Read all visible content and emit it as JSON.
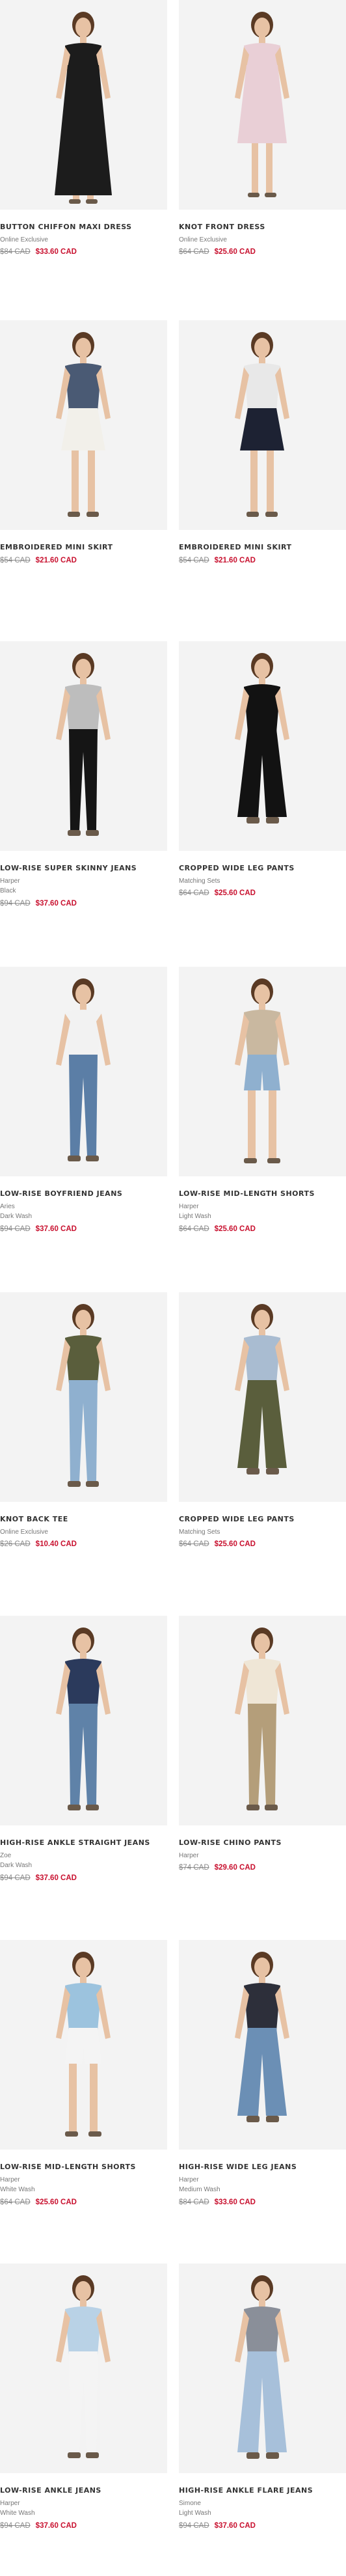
{
  "colors": {
    "sale": "#c8102e",
    "original": "#8a8a8a",
    "background": "#ffffff",
    "photo_background": "#f3f3f3"
  },
  "products": [
    {
      "name": "BUTTON CHIFFON MAXI DRESS",
      "meta1": "Online Exclusive",
      "meta2": "",
      "original_price": "$84 CAD",
      "sale_price": "$33.60 CAD",
      "image_icon": "model-maxi-dress-photo",
      "garment_color": "#1c1c1c",
      "top_color": "#1c1c1c",
      "kind": "maxi"
    },
    {
      "name": "KNOT FRONT DRESS",
      "meta1": "Online Exclusive",
      "meta2": "",
      "original_price": "$64 CAD",
      "sale_price": "$25.60 CAD",
      "image_icon": "model-floral-dress-photo",
      "garment_color": "#e9cfd6",
      "top_color": "#e9cfd6",
      "kind": "dress"
    },
    {
      "name": "EMBROIDERED MINI SKIRT",
      "meta1": "",
      "meta2": "",
      "original_price": "$54 CAD",
      "sale_price": "$21.60 CAD",
      "image_icon": "model-white-skirt-photo",
      "garment_color": "#f2f0ea",
      "top_color": "#4a5a74",
      "kind": "skirt"
    },
    {
      "name": "EMBROIDERED MINI SKIRT",
      "meta1": "",
      "meta2": "",
      "original_price": "$54 CAD",
      "sale_price": "$21.60 CAD",
      "image_icon": "model-navy-skirt-photo",
      "garment_color": "#1d2233",
      "top_color": "#e8e8e8",
      "kind": "skirt"
    },
    {
      "name": "LOW-RISE SUPER SKINNY JEANS",
      "meta1": "Harper",
      "meta2": "Black",
      "original_price": "$94 CAD",
      "sale_price": "$37.60 CAD",
      "image_icon": "model-black-jeans-photo",
      "garment_color": "#151515",
      "top_color": "#bdbdbd",
      "kind": "pants"
    },
    {
      "name": "CROPPED WIDE LEG PANTS",
      "meta1": "Matching Sets",
      "meta2": "",
      "original_price": "$64 CAD",
      "sale_price": "$25.60 CAD",
      "image_icon": "model-black-wide-pants-photo",
      "garment_color": "#121212",
      "top_color": "#121212",
      "kind": "wide"
    },
    {
      "name": "LOW-RISE BOYFRIEND JEANS",
      "meta1": "Aries",
      "meta2": "Dark Wash",
      "original_price": "$94 CAD",
      "sale_price": "$37.60 CAD",
      "image_icon": "model-boyfriend-jeans-photo",
      "garment_color": "#5b7ea6",
      "top_color": "#f2f2f2",
      "kind": "pants"
    },
    {
      "name": "LOW-RISE MID-LENGTH SHORTS",
      "meta1": "Harper",
      "meta2": "Light Wash",
      "original_price": "$64 CAD",
      "sale_price": "$25.60 CAD",
      "image_icon": "model-denim-shorts-photo",
      "garment_color": "#8fb0cf",
      "top_color": "#c9b8a0",
      "kind": "shorts"
    },
    {
      "name": "KNOT BACK TEE",
      "meta1": "Online Exclusive",
      "meta2": "",
      "original_price": "$26 CAD",
      "sale_price": "$10.40 CAD",
      "image_icon": "model-olive-tee-photo",
      "garment_color": "#8fb0cf",
      "top_color": "#5a5e3c",
      "kind": "pants"
    },
    {
      "name": "CROPPED WIDE LEG PANTS",
      "meta1": "Matching Sets",
      "meta2": "",
      "original_price": "$64 CAD",
      "sale_price": "$25.60 CAD",
      "image_icon": "model-olive-wide-pants-photo",
      "garment_color": "#5a5e3c",
      "top_color": "#a9bcd1",
      "kind": "wide"
    },
    {
      "name": "HIGH-RISE ANKLE STRAIGHT JEANS",
      "meta1": "Zoe",
      "meta2": "Dark Wash",
      "original_price": "$94 CAD",
      "sale_price": "$37.60 CAD",
      "image_icon": "model-straight-jeans-photo",
      "garment_color": "#5f82a8",
      "top_color": "#2b3a5c",
      "kind": "pants"
    },
    {
      "name": "LOW-RISE CHINO PANTS",
      "meta1": "Harper",
      "meta2": "",
      "original_price": "$74 CAD",
      "sale_price": "$29.60 CAD",
      "image_icon": "model-chino-pants-photo",
      "garment_color": "#b49e7a",
      "top_color": "#efe6d6",
      "kind": "pants"
    },
    {
      "name": "LOW-RISE MID-LENGTH SHORTS",
      "meta1": "Harper",
      "meta2": "White Wash",
      "original_price": "$64 CAD",
      "sale_price": "$25.60 CAD",
      "image_icon": "model-white-shorts-photo",
      "garment_color": "#f4f4f4",
      "top_color": "#9cc3de",
      "kind": "shorts"
    },
    {
      "name": "HIGH-RISE WIDE LEG JEANS",
      "meta1": "Harper",
      "meta2": "Medium Wash",
      "original_price": "$84 CAD",
      "sale_price": "$33.60 CAD",
      "image_icon": "model-wide-leg-jeans-photo",
      "garment_color": "#6b8fb5",
      "top_color": "#2d2f3a",
      "kind": "wide"
    },
    {
      "name": "LOW-RISE ANKLE JEANS",
      "meta1": "Harper",
      "meta2": "White Wash",
      "original_price": "$94 CAD",
      "sale_price": "$37.60 CAD",
      "image_icon": "model-white-jeans-photo",
      "garment_color": "#f4f4f4",
      "top_color": "#b9d2e6",
      "kind": "pants"
    },
    {
      "name": "HIGH-RISE ANKLE FLARE JEANS",
      "meta1": "Simone",
      "meta2": "Light Wash",
      "original_price": "$94 CAD",
      "sale_price": "$37.60 CAD",
      "image_icon": "model-flare-jeans-photo",
      "garment_color": "#a7c0da",
      "top_color": "#8a8f99",
      "kind": "flare"
    }
  ]
}
